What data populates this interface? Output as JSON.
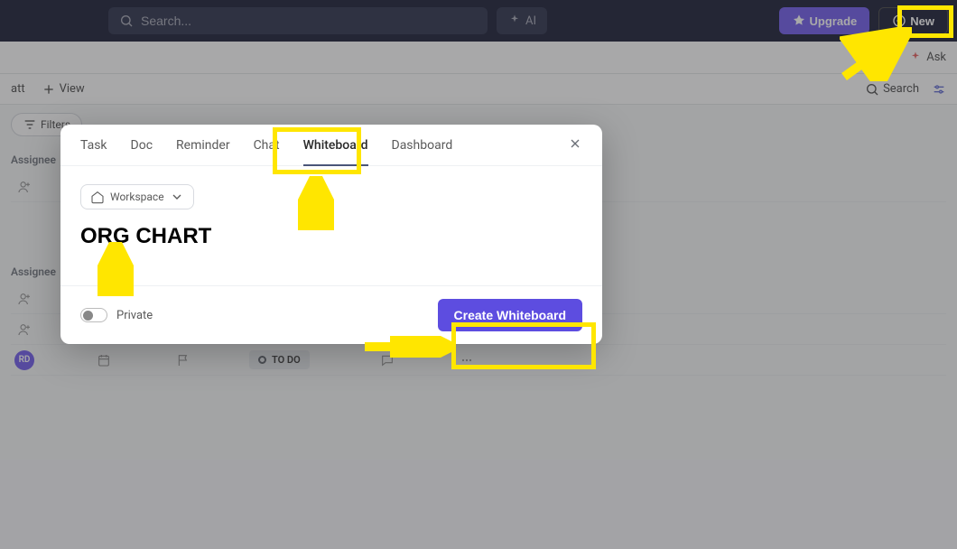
{
  "topbar": {
    "search_placeholder": "Search...",
    "ai_label": "AI",
    "upgrade_label": "Upgrade",
    "new_label": "New"
  },
  "subbar": {
    "ask_label": "Ask"
  },
  "viewbar": {
    "truncated_label": "att",
    "add_view_label": "View",
    "search_label": "Search"
  },
  "filter": {
    "filters_label": "Filters"
  },
  "board": {
    "group_label": "Assignee",
    "status_label": "TO DO",
    "avatar_initials": "RD"
  },
  "modal": {
    "tabs": {
      "task": "Task",
      "doc": "Doc",
      "reminder": "Reminder",
      "chat": "Chat",
      "whiteboard": "Whiteboard",
      "dashboard": "Dashboard"
    },
    "location_label": "Workspace",
    "title_value": "ORG CHART",
    "private_label": "Private",
    "create_label": "Create Whiteboard"
  }
}
